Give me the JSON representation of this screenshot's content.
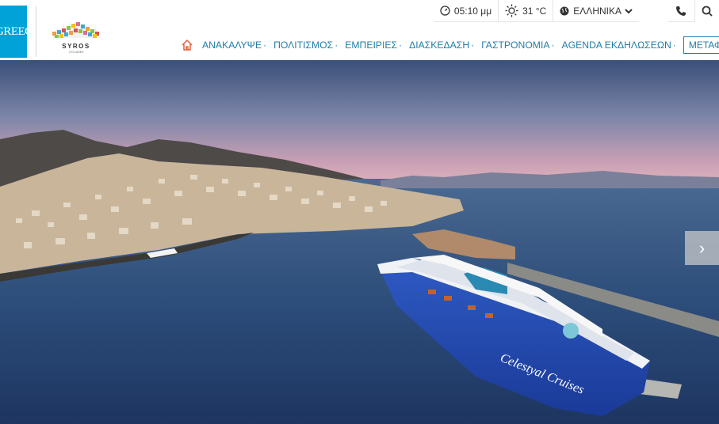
{
  "logos": {
    "greece_text": "GREECE",
    "syros_name": "SYROS",
    "syros_sub": "CYCLADES"
  },
  "topbar": {
    "time": "05:10 μμ",
    "temperature": "31 °C",
    "language": "ΕΛΛΗΝΙΚΑ"
  },
  "nav": {
    "items": [
      "ΑΝΑΚΑΛΥΨΕ",
      "ΠΟΛΙΤΙΣΜΟΣ",
      "ΕΜΠΕΙΡΙΕΣ",
      "ΔΙΑΣΚΕΔΑΣΗ",
      "ΓΑΣΤΡΟΝΟΜΙΑ",
      "AGENDA ΕΚΔΗΛΩΣΕΩΝ"
    ],
    "menu_button": "ΜΕΤΑΦ"
  },
  "hero": {
    "ship_hull_text": "Celestyal Cruises",
    "next_arrow": "›"
  },
  "colors": {
    "accent": "#1f7ea8",
    "greece_blue": "#00a2d8",
    "home_icon": "#e0603b"
  }
}
